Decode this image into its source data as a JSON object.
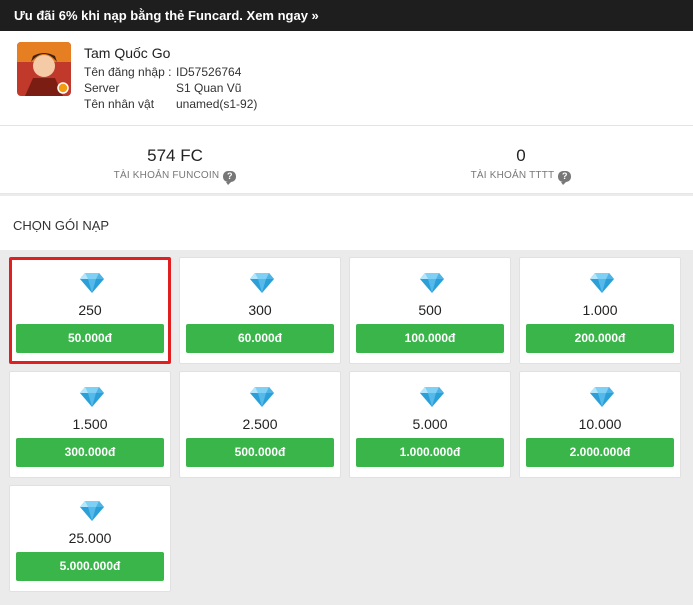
{
  "promo": {
    "text": "Ưu đãi 6% khi nạp bằng thẻ Funcard. Xem ngay »"
  },
  "game": {
    "avatar_icon": "game-avatar",
    "name": "Tam Quốc Go",
    "login_label": "Tên đăng nhập :",
    "login_value": "ID57526764",
    "server_label": "Server",
    "server_value": "S1 Quan Vũ",
    "character_label": "Tên nhân vật",
    "character_value": "unamed(s1-92)"
  },
  "balances": {
    "funcoin_value": "574 FC",
    "funcoin_label": "TÀI KHOẢN FUNCOIN",
    "tttt_value": "0",
    "tttt_label": "TÀI KHOẢN TTTT",
    "help_glyph": "?"
  },
  "section": {
    "title": "CHỌN GÓI NẠP"
  },
  "packages": [
    {
      "amount": "250",
      "price": "50.000đ",
      "selected": true
    },
    {
      "amount": "300",
      "price": "60.000đ"
    },
    {
      "amount": "500",
      "price": "100.000đ"
    },
    {
      "amount": "1.000",
      "price": "200.000đ"
    },
    {
      "amount": "1.500",
      "price": "300.000đ"
    },
    {
      "amount": "2.500",
      "price": "500.000đ"
    },
    {
      "amount": "5.000",
      "price": "1.000.000đ"
    },
    {
      "amount": "10.000",
      "price": "2.000.000đ"
    },
    {
      "amount": "25.000",
      "price": "5.000.000đ"
    }
  ],
  "colors": {
    "price_button": "#39b54a",
    "selected_border": "#e02020",
    "promo_bar": "#1e1e1e",
    "gem": "#2a9fd8"
  }
}
